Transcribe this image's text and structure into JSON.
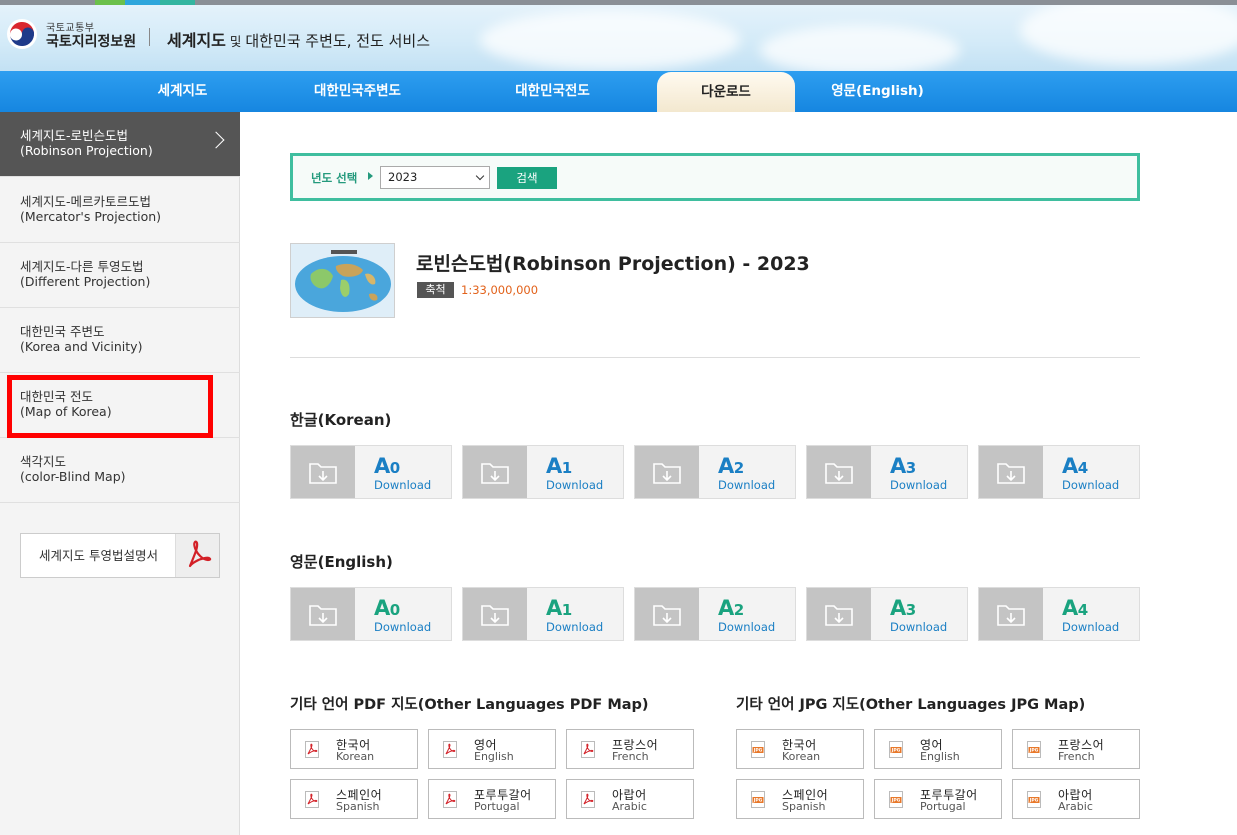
{
  "header": {
    "org_small": "국토교통부",
    "org_name": "국토지리정보원",
    "service_bold": "세계지도",
    "service_connector": " 및 ",
    "service_rest": "대한민국 주변도, 전도 서비스"
  },
  "nav": {
    "items": [
      {
        "label": "세계지도"
      },
      {
        "label": "대한민국주변도"
      },
      {
        "label": "대한민국전도"
      },
      {
        "label": "다운로드",
        "active": true
      },
      {
        "label": "영문(English)"
      }
    ]
  },
  "sidebar": {
    "items": [
      {
        "ko": "세계지도-로빈슨도법",
        "en": "(Robinson Projection)",
        "active": true
      },
      {
        "ko": "세계지도-메르카토르도법",
        "en": "(Mercator's Projection)"
      },
      {
        "ko": "세계지도-다른 투영도법",
        "en": "(Different Projection)"
      },
      {
        "ko": "대한민국 주변도",
        "en": "(Korea and Vicinity)"
      },
      {
        "ko": "대한민국 전도",
        "en": "(Map of Korea)",
        "highlighted": true
      },
      {
        "ko": "색각지도",
        "en": "(color-Blind Map)"
      }
    ],
    "pdf_button": "세계지도 투영법설명서"
  },
  "filter": {
    "label": "년도 선택",
    "year": "2023",
    "search": "검색"
  },
  "map": {
    "title": "로빈슨도법(Robinson Projection) - 2023",
    "scale_label": "축척",
    "scale_value": "1:33,000,000"
  },
  "korean_section": {
    "title": "한글(Korean)",
    "items": [
      {
        "size": "A0",
        "label": "Download"
      },
      {
        "size": "A1",
        "label": "Download"
      },
      {
        "size": "A2",
        "label": "Download"
      },
      {
        "size": "A3",
        "label": "Download"
      },
      {
        "size": "A4",
        "label": "Download"
      }
    ]
  },
  "english_section": {
    "title": "영문(English)",
    "items": [
      {
        "size": "A0",
        "label": "Download"
      },
      {
        "size": "A1",
        "label": "Download"
      },
      {
        "size": "A2",
        "label": "Download"
      },
      {
        "size": "A3",
        "label": "Download"
      },
      {
        "size": "A4",
        "label": "Download"
      }
    ]
  },
  "other_pdf": {
    "title": "기타 언어 PDF 지도(Other Languages PDF Map)",
    "items": [
      {
        "ko": "한국어",
        "en": "Korean"
      },
      {
        "ko": "영어",
        "en": "English"
      },
      {
        "ko": "프랑스어",
        "en": "French"
      },
      {
        "ko": "스페인어",
        "en": "Spanish"
      },
      {
        "ko": "포루투갈어",
        "en": "Portugal"
      },
      {
        "ko": "아랍어",
        "en": "Arabic"
      }
    ]
  },
  "other_jpg": {
    "title": "기타 언어 JPG 지도(Other Languages JPG Map)",
    "items": [
      {
        "ko": "한국어",
        "en": "Korean"
      },
      {
        "ko": "영어",
        "en": "English"
      },
      {
        "ko": "프랑스어",
        "en": "French"
      },
      {
        "ko": "스페인어",
        "en": "Spanish"
      },
      {
        "ko": "포루투갈어",
        "en": "Portugal"
      },
      {
        "ko": "아랍어",
        "en": "Arabic"
      }
    ]
  },
  "colors": {
    "nav_blue": "#1686e0",
    "teal": "#1aa37f",
    "download_blue": "#1a7fc4",
    "highlight_red": "#ff0000",
    "scale_orange": "#e2621b"
  },
  "icons": {
    "logo": "korea-government-emblem-icon",
    "chevron": "chevron-right-icon",
    "pdf": "acrobat-pdf-icon",
    "folder": "folder-download-icon",
    "jpg": "jpg-file-icon"
  }
}
